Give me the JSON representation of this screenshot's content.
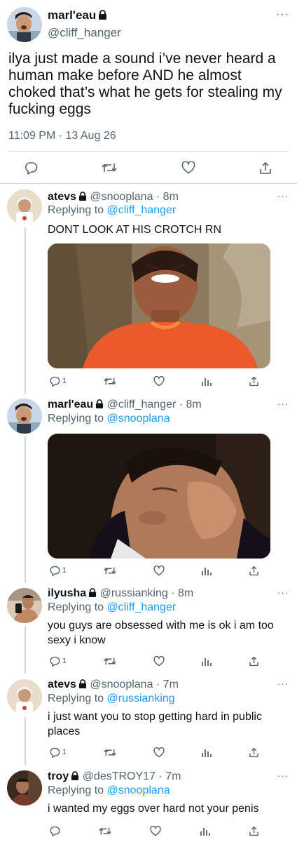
{
  "main_tweet": {
    "display_name": "marl'eau",
    "handle": "@cliff_hanger",
    "text": "ilya just made a sound i’ve never heard a human make before AND he almost choked that’s what he gets for stealing my fucking eggs",
    "timestamp": "11:09 PM · 13 Aug 26",
    "more": "···"
  },
  "replies": [
    {
      "display_name": "atevs",
      "meta": "@snooplana · 8m",
      "replying_prefix": "Replying to ",
      "replying_to": "@cliff_hanger",
      "text": "DONT LOOK AT HIS CROTCH RN",
      "reply_count": "1",
      "more": "···"
    },
    {
      "display_name": "marl'eau",
      "meta": "@cliff_hanger · 8m",
      "replying_prefix": "Replying to ",
      "replying_to": "@snooplana",
      "text": "",
      "reply_count": "1",
      "more": "···"
    },
    {
      "display_name": "ilyusha",
      "meta": "@russianking · 8m",
      "replying_prefix": "Replying to ",
      "replying_to": "@cliff_hanger",
      "text": "you guys are obsessed with me is ok i am too sexy i know",
      "reply_count": "1",
      "more": "···"
    },
    {
      "display_name": "atevs",
      "meta": "@snooplana · 7m",
      "replying_prefix": "Replying to ",
      "replying_to": "@russianking",
      "text": "i just want you to stop getting hard in public places",
      "reply_count": "1",
      "more": "···"
    },
    {
      "display_name": "troy",
      "meta": "@desTROY17 · 7m",
      "replying_prefix": "Replying to ",
      "replying_to": "@snooplana",
      "text": "i wanted my eggs over hard not your penis",
      "reply_count": "",
      "more": "···"
    }
  ],
  "icons": [
    "lock-icon",
    "reply-icon",
    "retweet-icon",
    "like-icon",
    "analytics-icon",
    "share-icon",
    "more-icon"
  ],
  "colors": {
    "text": "#0f1419",
    "secondary": "#536471",
    "link": "#1d9bf0",
    "divider": "#cfd9de"
  }
}
